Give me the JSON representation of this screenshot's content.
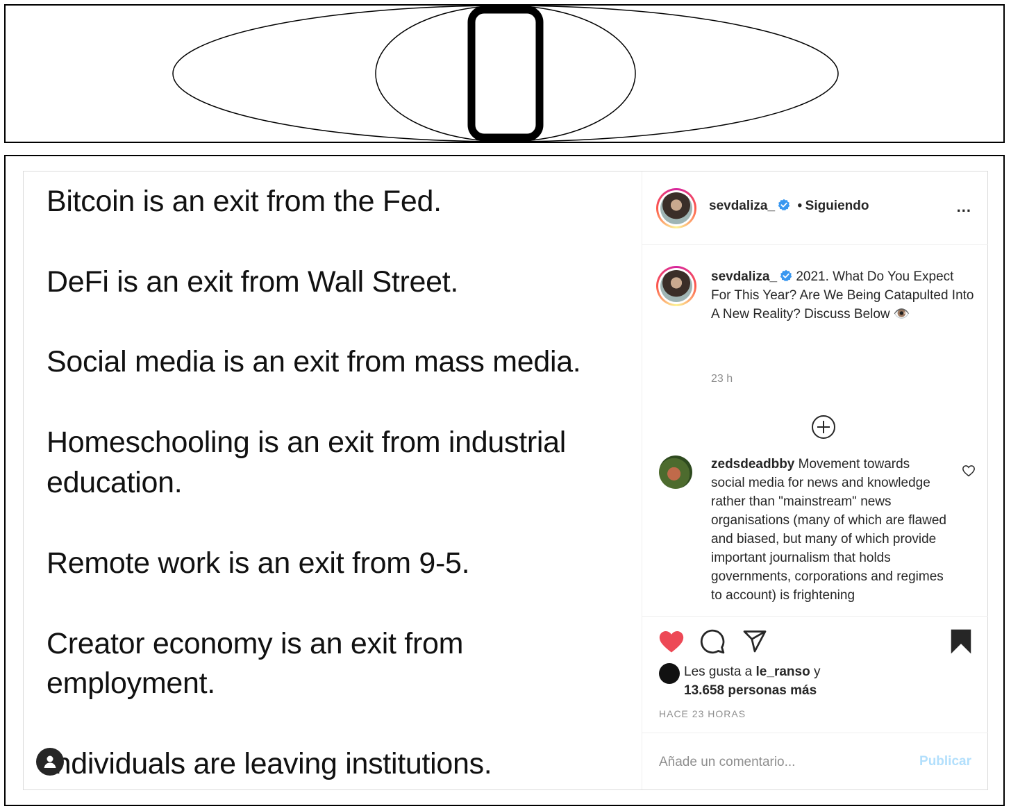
{
  "post_text_lines": [
    "Bitcoin is an exit from the Fed.",
    "DeFi is an exit from Wall Street.",
    "Social media is an exit from mass media.",
    "Homeschooling is an exit from industrial",
    "education.",
    "Remote work is an exit from 9-5.",
    "Creator economy is an exit from",
    "employment.",
    "Individuals are leaving institutions."
  ],
  "header": {
    "username": "sevdaliza_",
    "separator": "•",
    "follow_status": "Siguiendo",
    "more": "..."
  },
  "caption": {
    "username": "sevdaliza_",
    "text": "2021. What Do You Expect For This Year? Are We Being Catapulted Into A New Reality? Discuss Below 👁️",
    "time": "23 h"
  },
  "comment": {
    "username": "zedsdeadbby",
    "text": "Movement towards social media for news and knowledge rather than \"mainstream\" news organisations (many of which are flawed and biased, but many of which provide important journalism that holds governments, corporations and regimes to account) is frightening"
  },
  "likes": {
    "prefix": "Les gusta a",
    "user": "le_ranso",
    "conjunction": "y",
    "others": "13.658 personas más"
  },
  "posted_time": "HACE 23 HORAS",
  "comment_input": {
    "placeholder": "Añade un comentario...",
    "publish_label": "Publicar"
  },
  "colors": {
    "like_red": "#ed4956",
    "publish_disabled": "#b2dffc",
    "verified_blue": "#3897f0",
    "muted_gray": "#8e8e8e"
  }
}
